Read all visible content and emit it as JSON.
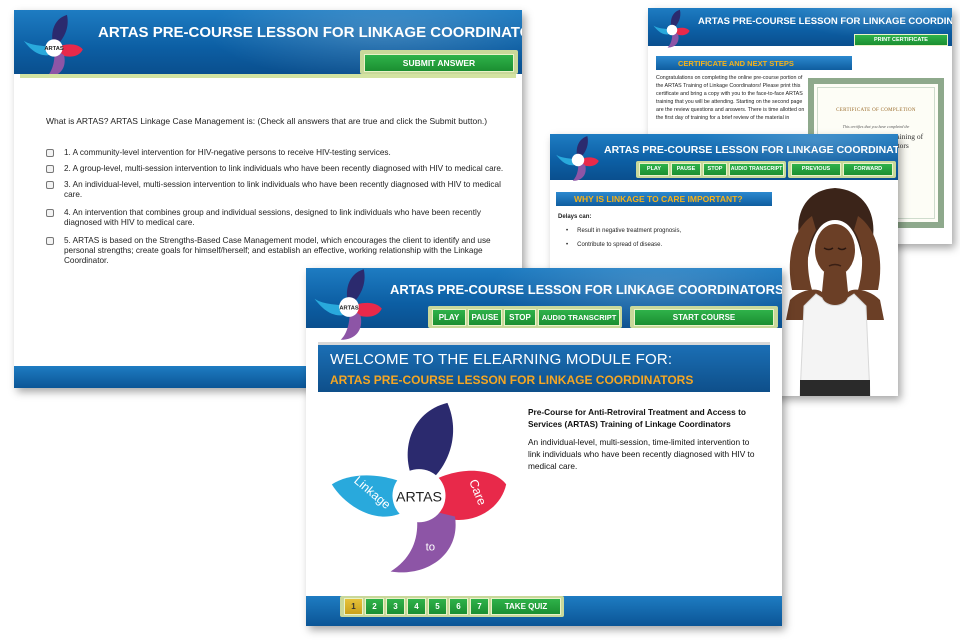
{
  "course": {
    "header_title": "ARTAS PRE-COURSE LESSON FOR LINKAGE COORDINATORS"
  },
  "logo": {
    "center": "ARTAS",
    "word_left": "Linkage",
    "word_right": "Care",
    "word_bottom": "to",
    "colors": {
      "navy": "#2b2a6e",
      "cyan": "#29a9dc",
      "red": "#e8294a",
      "purple": "#8d55a6"
    }
  },
  "quiz_window": {
    "submit_label": "SUBMIT ANSWER",
    "question": "What is ARTAS? ARTAS Linkage Case Management is:  (Check all answers that are true and click the Submit button.)",
    "options": [
      "1. A community-level intervention for HIV-negative persons to receive HIV-testing services.",
      "2. A group-level, multi-session intervention to link individuals who have been recently diagnosed with HIV to medical care.",
      "3. An individual-level, multi-session intervention to link individuals who have been recently diagnosed with HIV to medical care.",
      "4. An intervention that combines group and individual sessions, designed to link individuals who have been recently diagnosed with HIV to medical care.",
      "5. ARTAS is based on the Strengths-Based Case Management model, which encourages the client to identify and use personal strengths; create goals for himself/herself; and establish an effective, working relationship with the Linkage Coordinator."
    ]
  },
  "certificate_window": {
    "print_label": "PRINT CERTIFICATE",
    "section_title": "CERTIFICATE AND NEXT STEPS",
    "body": "Congratulations on completing the online pre-course portion of the ARTAS Training of Linkage Coordinators! Please print this certificate and bring a copy with you to the face-to-face ARTAS training that you will be attending. Starting on the second page are the review questions and answers. There is time allotted on the first day of training for a brief review of the material in",
    "cert_title": "CERTIFICATE OF COMPLETION",
    "cert_sub": "This certifies that you have completed the",
    "cert_name": "Pre-Course ARTAS Training of Linkage Coordinators"
  },
  "why_window": {
    "buttons": [
      "PLAY",
      "PAUSE",
      "STOP",
      "AUDIO TRANSCRIPT"
    ],
    "nav": [
      "PREVIOUS",
      "FORWARD"
    ],
    "section_title": "WHY IS LINKAGE TO CARE IMPORTANT?",
    "delays_label": "Delays can:",
    "bullets": [
      "Result in negative treatment prognosis,",
      "Contribute to spread of disease."
    ]
  },
  "welcome_window": {
    "buttons": [
      "PLAY",
      "PAUSE",
      "STOP",
      "AUDIO TRANSCRIPT"
    ],
    "start_label": "START COURSE",
    "welcome_line1": "WELCOME TO THE ELEARNING MODULE FOR:",
    "welcome_line2": "ARTAS PRE-COURSE LESSON FOR LINKAGE COORDINATORS",
    "intro_title": "Pre-Course for Anti-Retroviral Treatment and Access to Services (ARTAS) Training of Linkage Coordinators",
    "intro_desc": "An individual-level, multi-session, time-limited intervention to link individuals who have been recently diagnosed with HIV to medical care.",
    "pages": [
      "1",
      "2",
      "3",
      "4",
      "5",
      "6",
      "7"
    ],
    "active_page": "1",
    "quiz_label": "TAKE QUIZ"
  }
}
